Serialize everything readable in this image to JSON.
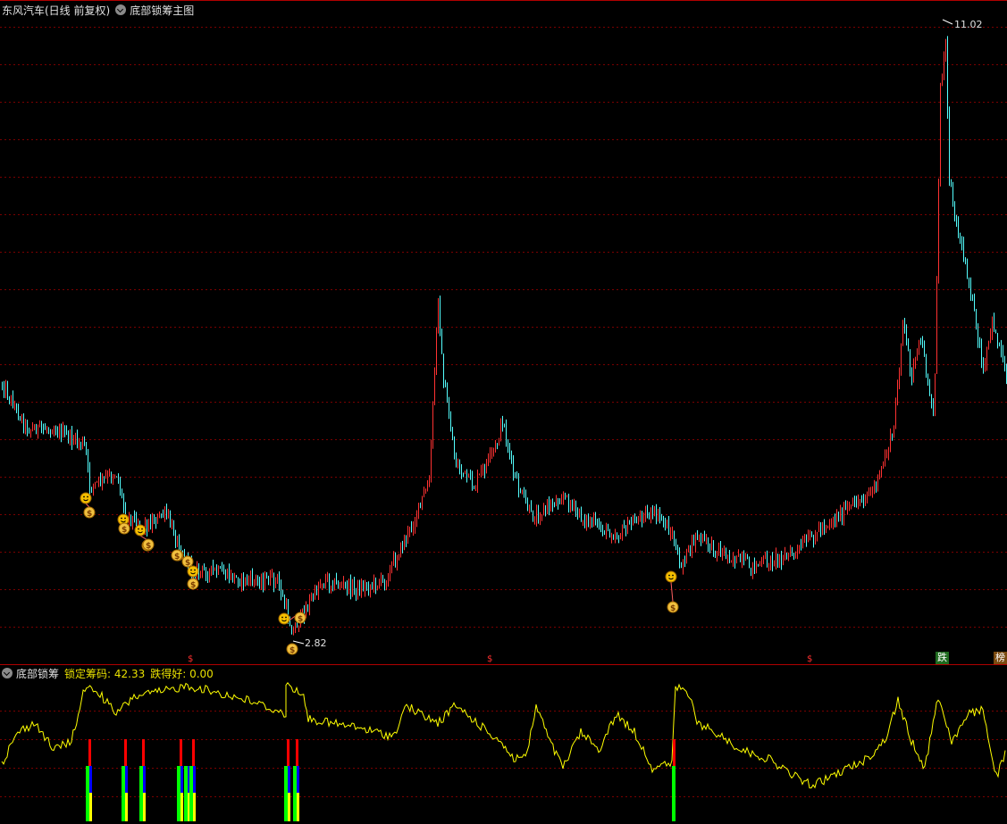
{
  "header": {
    "stock_name": "东风汽车(日线 前复权)",
    "indicator_main": "底部锁筹主图"
  },
  "sub_header": {
    "indicator_name": "底部锁筹",
    "locked_label": "锁定筹码: 42.33",
    "fall_label": "跌得好: 0.00"
  },
  "price_labels": {
    "high": "11.02",
    "low": "2.82"
  },
  "tags": {
    "fall": "跌",
    "rank": "榜"
  },
  "colors": {
    "bg": "#000000",
    "up": "#ff3232",
    "down": "#54ffff",
    "grid": "#7a0000",
    "axis": "#b00000",
    "line": "#ffff00",
    "green": "#00ff00",
    "blue": "#0000ff",
    "yellow": "#ffff00",
    "red": "#ff0000"
  },
  "icons": {
    "smile": "smiley-face-icon",
    "money": "money-bag-icon",
    "dollar": "dollar-sign-icon"
  }
}
